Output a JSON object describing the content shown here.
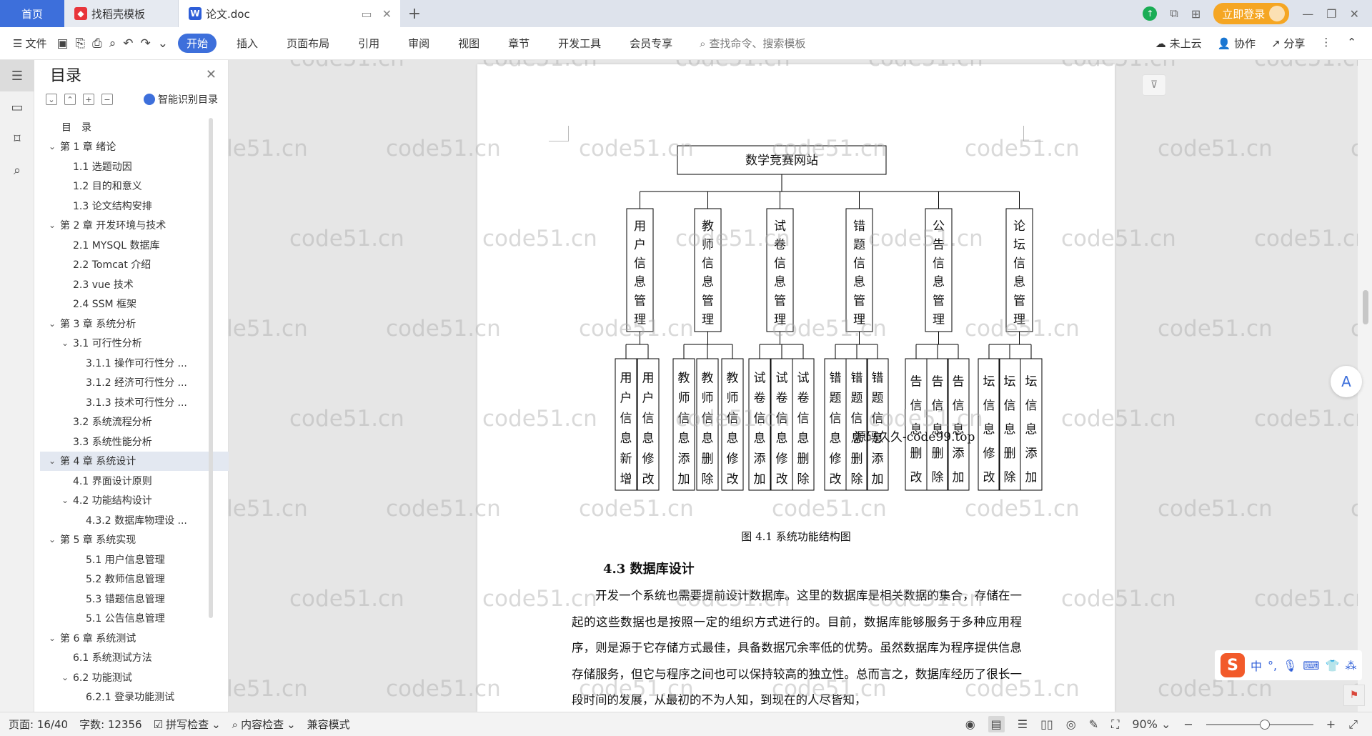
{
  "titlebar": {
    "tabs": [
      {
        "label": "首页"
      },
      {
        "label": "找稻壳模板",
        "icon": "daoke-icon"
      },
      {
        "label": "论文.doc",
        "icon": "wps-writer-icon"
      }
    ],
    "login_label": "立即登录"
  },
  "ribbon": {
    "file_label": "文件",
    "tabs": [
      "开始",
      "插入",
      "页面布局",
      "引用",
      "审阅",
      "视图",
      "章节",
      "开发工具",
      "会员专享"
    ],
    "active_tab": "开始",
    "search_placeholder": "查找命令、搜索模板",
    "cloud_label": "未上云",
    "collab_label": "协作",
    "share_label": "分享"
  },
  "toc": {
    "title": "目录",
    "smart_label": "智能识别目录",
    "items": [
      {
        "label": "目　录",
        "level": 0,
        "chev": ""
      },
      {
        "label": "第 1 章  绪论",
        "level": 1,
        "chev": "⌄"
      },
      {
        "label": "1.1 选题动因",
        "level": 2,
        "chev": ""
      },
      {
        "label": "1.2 目的和意义",
        "level": 2,
        "chev": ""
      },
      {
        "label": "1.3 论文结构安排",
        "level": 2,
        "chev": ""
      },
      {
        "label": "第 2 章  开发环境与技术",
        "level": 1,
        "chev": "⌄"
      },
      {
        "label": "2.1 MYSQL 数据库",
        "level": 2,
        "chev": ""
      },
      {
        "label": "2.2 Tomcat  介绍",
        "level": 2,
        "chev": ""
      },
      {
        "label": "2.3 vue 技术",
        "level": 2,
        "chev": ""
      },
      {
        "label": "2.4 SSM 框架",
        "level": 2,
        "chev": ""
      },
      {
        "label": "第 3 章  系统分析",
        "level": 1,
        "chev": "⌄"
      },
      {
        "label": "3.1 可行性分析",
        "level": 2,
        "chev": "⌄"
      },
      {
        "label": "3.1.1 操作可行性分 ...",
        "level": 3,
        "chev": ""
      },
      {
        "label": "3.1.2 经济可行性分 ...",
        "level": 3,
        "chev": ""
      },
      {
        "label": "3.1.3 技术可行性分 ...",
        "level": 3,
        "chev": ""
      },
      {
        "label": "3.2 系统流程分析",
        "level": 2,
        "chev": ""
      },
      {
        "label": "3.3 系统性能分析",
        "level": 2,
        "chev": ""
      },
      {
        "label": "第 4 章  系统设计",
        "level": 1,
        "chev": "⌄",
        "selected": true
      },
      {
        "label": "4.1 界面设计原则",
        "level": 2,
        "chev": ""
      },
      {
        "label": "4.2 功能结构设计",
        "level": 2,
        "chev": "⌄"
      },
      {
        "label": "4.3.2  数据库物理设 ...",
        "level": 3,
        "chev": ""
      },
      {
        "label": "第 5 章  系统实现",
        "level": 1,
        "chev": "⌄"
      },
      {
        "label": "5.1 用户信息管理",
        "level": 3,
        "chev": ""
      },
      {
        "label": "5.2  教师信息管理",
        "level": 3,
        "chev": ""
      },
      {
        "label": "5.3 错题信息管理",
        "level": 3,
        "chev": ""
      },
      {
        "label": "5.1 公告信息管理",
        "level": 3,
        "chev": ""
      },
      {
        "label": "第 6 章  系统测试",
        "level": 1,
        "chev": "⌄"
      },
      {
        "label": "6.1  系统测试方法",
        "level": 2,
        "chev": ""
      },
      {
        "label": "6.2  功能测试",
        "level": 2,
        "chev": "⌄"
      },
      {
        "label": "6.2.1  登录功能测试",
        "level": 3,
        "chev": ""
      }
    ]
  },
  "document": {
    "diagram": {
      "root": "数学竞赛网站",
      "modules": [
        {
          "name": "用户信息管理",
          "children": [
            "用户信息新增",
            "用户信息修改"
          ]
        },
        {
          "name": "教师信息管理",
          "children": [
            "教师信息添加",
            "教师信息删除",
            "教师信息修改"
          ]
        },
        {
          "name": "试卷信息管理",
          "children": [
            "试卷信息添加",
            "试卷信息修改",
            "试卷信息删除"
          ]
        },
        {
          "name": "错题信息管理",
          "children": [
            "错题信息修改",
            "错题信息删除",
            "错题信息添加"
          ]
        },
        {
          "name": "公告信息管理",
          "children": [
            "告信息删改",
            "告信息删除",
            "告信息添加"
          ]
        },
        {
          "name": "论坛信息管理",
          "children": [
            "坛信息修改",
            "坛信息删除",
            "坛信息添加"
          ]
        }
      ]
    },
    "overlay_text": "源码久久-code99.top",
    "figure_caption": "图 4.1  系统功能结构图",
    "section_heading": "4.3  数据库设计",
    "paragraph": "开发一个系统也需要提前设计数据库。这里的数据库是相关数据的集合，存储在一起的这些数据也是按照一定的组织方式进行的。目前，数据库能够服务于多种应用程序，则是源于它存储方式最佳，具备数据冗余率低的优势。虽然数据库为程序提供信息存储服务，但它与程序之间也可以保持较高的独立性。总而言之，数据库经历了很长一段时间的发展，从最初的不为人知，到现在的人尽皆知，",
    "watermark": "code51.cn"
  },
  "ime": {
    "lang": "中",
    "punct": "°,"
  },
  "statusbar": {
    "page": "页面: 16/40",
    "words": "字数: 12356",
    "spell": "拼写检查",
    "content_check": "内容检查",
    "compat": "兼容模式",
    "zoom": "90%"
  }
}
